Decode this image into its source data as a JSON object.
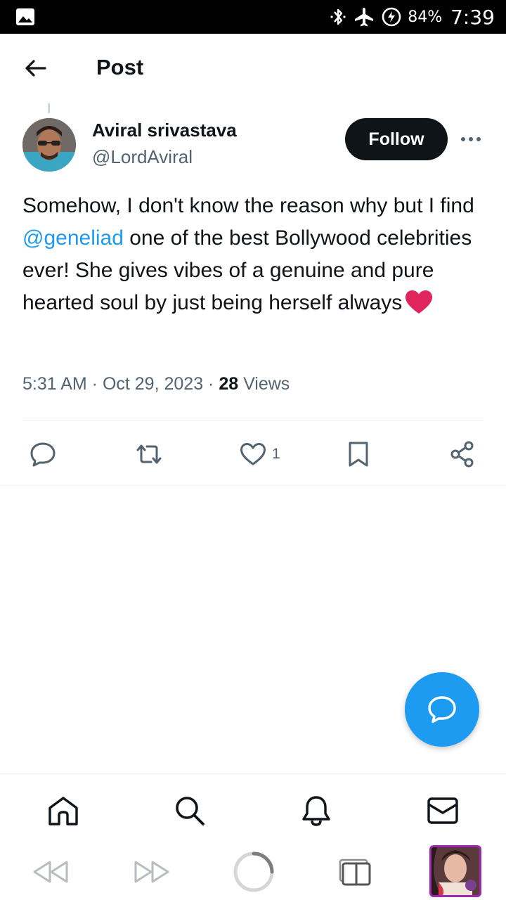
{
  "status_bar": {
    "battery": "84%",
    "time": "7:39",
    "icons": [
      "gallery-icon",
      "bluetooth-icon",
      "airplane-mode-icon",
      "battery-charging-icon"
    ]
  },
  "header": {
    "title": "Post",
    "back_icon": "arrow-left-icon"
  },
  "author": {
    "name": "Aviral srivastava",
    "handle": "@LordAviral",
    "follow_label": "Follow"
  },
  "post": {
    "text_before_mention": "Somehow, I don't know the reason why but I find ",
    "mention": "@geneliad",
    "text_after_mention": " one of the best Bollywood celebrities ever! She gives vibes of a genuine and pure hearted soul by just being herself always",
    "emoji": "red-heart-emoji",
    "timestamp": "5:31 AM · Oct 29, 2023",
    "separator": " · ",
    "views_count": "28",
    "views_label": " Views"
  },
  "actions": {
    "reply_icon": "reply-icon",
    "repost_icon": "repost-icon",
    "like_icon": "heart-icon",
    "like_count": "1",
    "bookmark_icon": "bookmark-icon",
    "share_icon": "share-icon"
  },
  "bottom_nav": {
    "items": [
      "home-icon",
      "search-icon",
      "notifications-icon",
      "messages-icon"
    ]
  },
  "browser_bar": {
    "items": [
      "rewind-icon",
      "fast-forward-icon",
      "loading-icon",
      "tabs-icon",
      "thumbnail"
    ]
  },
  "colors": {
    "accent": "#1d9bf0",
    "text_primary": "#0f1419",
    "text_secondary": "#536471",
    "heart_red": "#e0245e"
  }
}
